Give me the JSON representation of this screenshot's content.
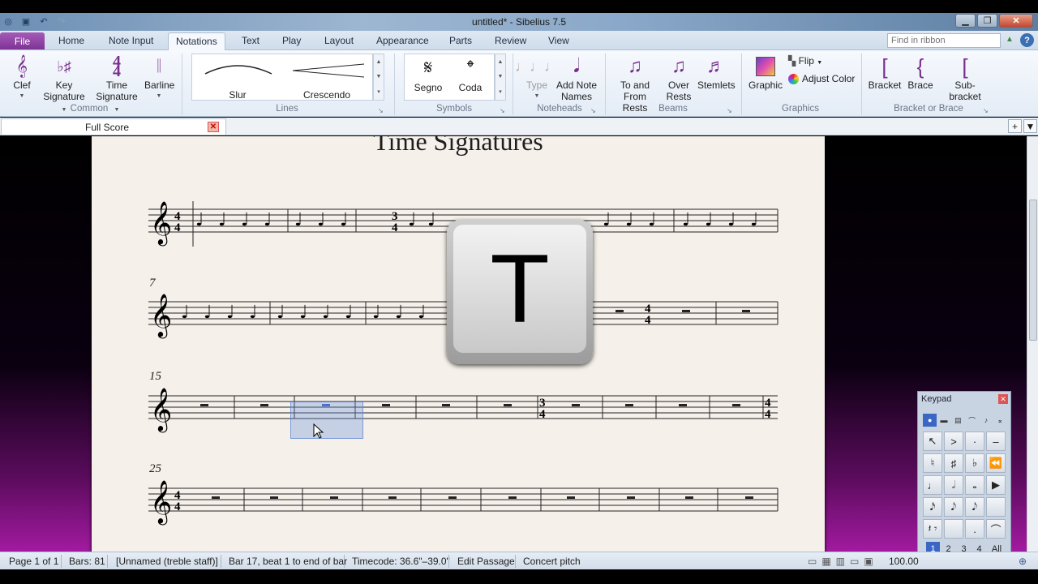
{
  "window": {
    "title": "untitled* - Sibelius 7.5"
  },
  "ribbon_tabs": [
    "Home",
    "Note Input",
    "Notations",
    "Text",
    "Play",
    "Layout",
    "Appearance",
    "Parts",
    "Review",
    "View"
  ],
  "file_tab": "File",
  "active_tab": "Notations",
  "find_placeholder": "Find in ribbon",
  "groups": {
    "common": {
      "label": "Common",
      "clef": "Clef",
      "key1": "Key",
      "key2": "Signature",
      "time1": "Time",
      "time2": "Signature",
      "barline": "Barline"
    },
    "lines": {
      "label": "Lines",
      "slur": "Slur",
      "crescendo": "Crescendo"
    },
    "symbols": {
      "label": "Symbols",
      "segno": "Segno",
      "coda": "Coda"
    },
    "noteheads": {
      "label": "Noteheads",
      "type": "Type",
      "add1": "Add Note",
      "add2": "Names"
    },
    "beams": {
      "label": "Beams",
      "tofrom1": "To and",
      "tofrom2": "From Rests",
      "over1": "Over",
      "over2": "Rests",
      "stemlets": "Stemlets"
    },
    "graphics": {
      "label": "Graphics",
      "graphic": "Graphic",
      "flip": "Flip",
      "adjust": "Adjust Color"
    },
    "bracket": {
      "label": "Bracket or Brace",
      "bracket": "Bracket",
      "brace": "Brace",
      "sub": "Sub-bracket"
    }
  },
  "document_tab": {
    "label": "Full Score"
  },
  "score": {
    "title": "Time Signatures",
    "system_numbers": [
      "7",
      "15",
      "25"
    ]
  },
  "overlay_key": "T",
  "keypad": {
    "title": "Keypad",
    "layouts": [
      "1",
      "2",
      "3",
      "4",
      "All"
    ],
    "keys": [
      "↖",
      ">",
      "·",
      "–",
      "♮",
      "♯",
      "♭",
      "⏪",
      "♩",
      "𝅗𝅥",
      "𝅝",
      "▶",
      "𝅘𝅥𝅯",
      "𝅘𝅥𝅮",
      "𝅘𝅥𝅮",
      "",
      "𝄽 𝄾",
      "",
      ".",
      "⌒"
    ]
  },
  "status": {
    "page": "Page 1 of 1",
    "bars": "Bars: 81",
    "instrument": "[Unnamed (treble staff)]",
    "selection": "Bar 17, beat 1 to end of bar",
    "timecode": "Timecode: 36.6\"–39.0\"",
    "mode": "Edit Passage",
    "pitch": "Concert pitch",
    "zoom": "100.00"
  },
  "colors": {
    "accent": "#7a2d8f",
    "selection": "#6e96dc"
  },
  "icons": [
    "clef-icon",
    "key-signature-icon",
    "time-signature-icon",
    "barline-icon",
    "segno-icon",
    "coda-icon",
    "graphic-icon",
    "bracket-icon",
    "brace-icon"
  ]
}
